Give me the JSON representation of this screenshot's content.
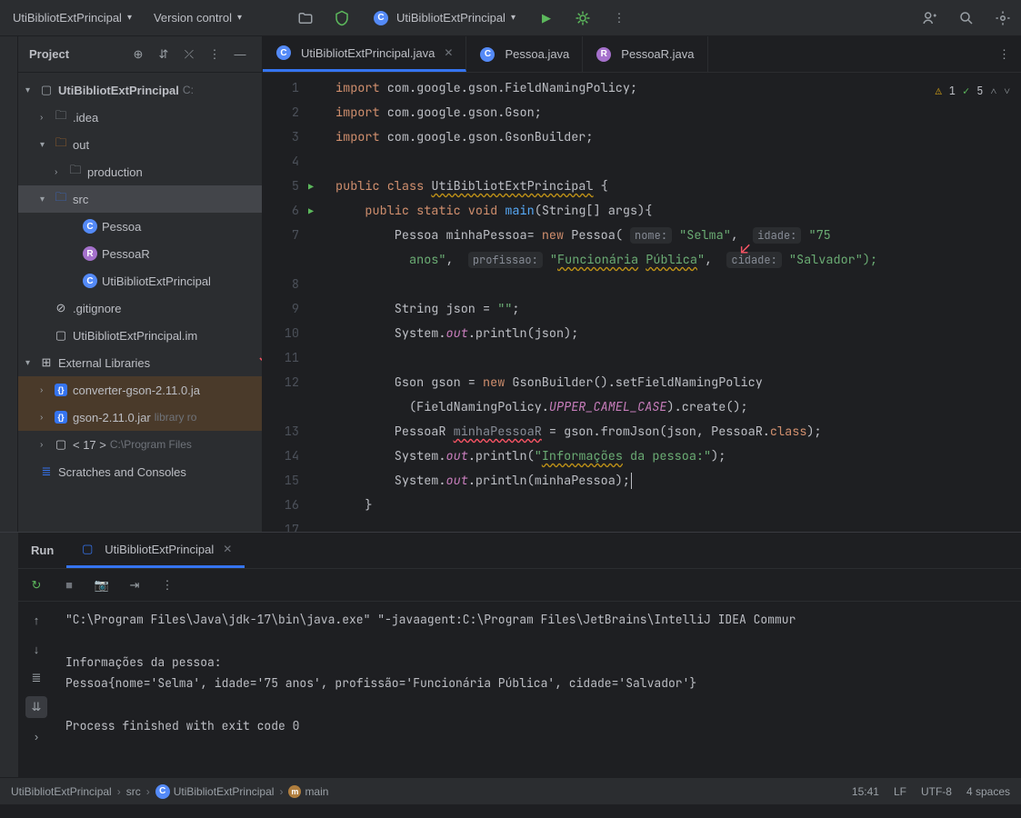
{
  "topBar": {
    "projectName": "UtiBibliotExtPrincipal",
    "versionControl": "Version control",
    "runConfig": "UtiBibliotExtPrincipal"
  },
  "sidebar": {
    "title": "Project"
  },
  "tree": {
    "root": "UtiBibliotExtPrincipal",
    "rootHint": "C:",
    "idea": ".idea",
    "out": "out",
    "production": "production",
    "src": "src",
    "pessoa": "Pessoa",
    "pessoaR": "PessoaR",
    "utiPrincipal": "UtiBibliotExtPrincipal",
    "gitignore": ".gitignore",
    "iml": "UtiBibliotExtPrincipal.im",
    "external": "External Libraries",
    "converter": "converter-gson-2.11.0.ja",
    "gson": "gson-2.11.0.jar",
    "gsonHint": "library ro",
    "jdk": "< 17 >",
    "jdkHint": "C:\\Program Files",
    "scratches": "Scratches and Consoles"
  },
  "tabs": {
    "t1": "UtiBibliotExtPrincipal.java",
    "t2": "Pessoa.java",
    "t3": "PessoaR.java"
  },
  "code": {
    "l1_import": "import",
    "l1_pkg": " com.google.gson.FieldNamingPolicy;",
    "l2_import": "import",
    "l2_pkg": " com.google.gson.Gson;",
    "l3_import": "import",
    "l3_pkg": " com.google.gson.GsonBuilder;",
    "l5_public": "public class ",
    "l5_name": "UtiBibliotExtPrincipal",
    "l5_brace": " {",
    "l6_mod": "    public static void ",
    "l6_main": "main",
    "l6_args": "(String[] args){",
    "l7_pre": "        Pessoa minhaPessoa= ",
    "l7_new": "new",
    "l7_pessoa": " Pessoa( ",
    "l7_h1": "nome:",
    "l7_v1": " \"Selma\"",
    "l7_c": ",  ",
    "l7_h2": "idade:",
    "l7_v2": " \"75",
    "l7b_v2": "          anos\"",
    "l7b_c": ",  ",
    "l7b_h3": "profissao:",
    "l7b_v3a": " \"",
    "l7b_v3b": "Funcionária",
    "l7b_v3c": " ",
    "l7b_v3d": "Pública",
    "l7b_v3e": "\"",
    "l7b_c2": ",  ",
    "l7b_h4": "cidade:",
    "l7b_v4": " \"Salvador\");",
    "l9": "        String json = ",
    "l9_str": "\"\"",
    "l9_sc": ";",
    "l10_a": "        System.",
    "l10_out": "out",
    "l10_b": ".println(json);",
    "l12_a": "        Gson gson = ",
    "l12_new": "new",
    "l12_b": " GsonBuilder().setFieldNamingPolicy",
    "l12b_a": "          (FieldNamingPolicy.",
    "l12b_b": "UPPER_CAMEL_CASE",
    "l12b_c": ").create();",
    "l13_a": "        PessoaR ",
    "l13_var": "minhaPessoaR",
    "l13_b": " = gson.fromJson(json, PessoaR.",
    "l13_class": "class",
    "l13_c": ");",
    "l14_a": "        System.",
    "l14_out": "out",
    "l14_b": ".println(",
    "l14_str_a": "\"",
    "l14_str_b": "Informações",
    "l14_str_c": " da pessoa:\"",
    "l14_c": ");",
    "l15_a": "        System.",
    "l15_out": "out",
    "l15_b": ".println(minhaPessoa);",
    "l16": "    }"
  },
  "corner": {
    "warn": "1",
    "check": "5"
  },
  "run": {
    "tabRun": "Run",
    "tabConfig": "UtiBibliotExtPrincipal",
    "out1": "\"C:\\Program Files\\Java\\jdk-17\\bin\\java.exe\" \"-javaagent:C:\\Program Files\\JetBrains\\IntelliJ IDEA Commur",
    "out2": "",
    "out3": "Informações da pessoa:",
    "out4": "Pessoa{nome='Selma', idade='75 anos', profissão='Funcionária Pública', cidade='Salvador'}",
    "out5": "",
    "out6": "Process finished with exit code 0"
  },
  "status": {
    "bc1": "UtiBibliotExtPrincipal",
    "bc2": "src",
    "bc3": "UtiBibliotExtPrincipal",
    "bc4": "main",
    "time": "15:41",
    "lf": "LF",
    "enc": "UTF-8",
    "indent": "4 spaces"
  },
  "lineNums": [
    "1",
    "2",
    "3",
    "4",
    "5",
    "6",
    "7",
    "",
    "8",
    "9",
    "10",
    "11",
    "12",
    "",
    "13",
    "14",
    "15",
    "16",
    "17"
  ]
}
